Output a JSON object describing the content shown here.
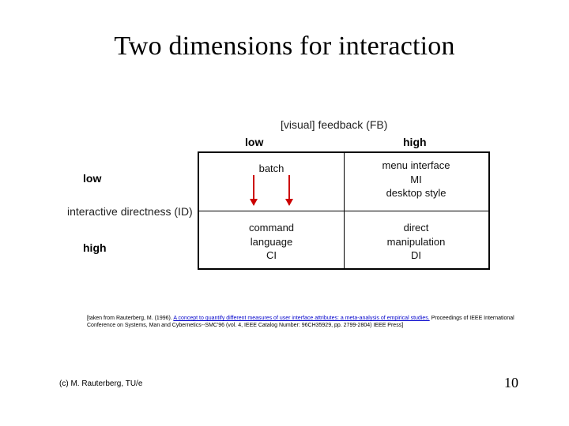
{
  "title": "Two dimensions for interaction",
  "axes": {
    "fb_label": "[visual] feedback (FB)",
    "fb_low": "low",
    "fb_high": "high",
    "id_label": "interactive directness (ID)",
    "id_low": "low",
    "id_high": "high"
  },
  "cells": {
    "tl": "batch",
    "tr_line1": "menu interface",
    "tr_line2": "MI",
    "tr_line3": "desktop style",
    "bl_line1": "command",
    "bl_line2": "language",
    "bl_line3": "CI",
    "br_line1": "direct",
    "br_line2": "manipulation",
    "br_line3": "DI"
  },
  "citation": {
    "prefix": "[taken from Rauterberg, M. (1996). ",
    "link": "A concept to quantify different measures of user interface attributes: a meta-analysis of empirical studies.",
    "suffix": " Proceedings of IEEE International Conference on Systems, Man and Cybernetics--SMC'96 (vol. 4, IEEE Catalog Number: 96CH35929, pp. 2799-2804) IEEE Press]"
  },
  "footer": {
    "left": "(c) M. Rauterberg, TU/e",
    "page": "10"
  }
}
